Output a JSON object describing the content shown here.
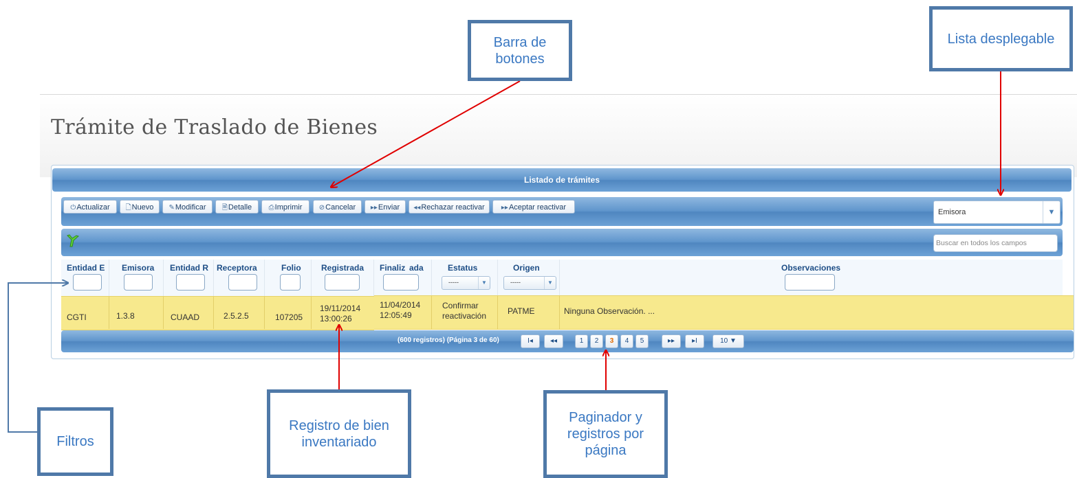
{
  "page": {
    "title": "Trámite de Traslado de Bienes"
  },
  "panel": {
    "title": "Listado de trámites"
  },
  "toolbar": {
    "buttons": [
      {
        "icon": "⏻",
        "label": "Actualizar"
      },
      {
        "icon": "🗋",
        "label": "Nuevo"
      },
      {
        "icon": "✎",
        "label": "Modificar"
      },
      {
        "icon": "🗎",
        "label": "Detalle"
      },
      {
        "icon": "⎙",
        "label": "Imprimir"
      },
      {
        "icon": "⊘",
        "label": "Cancelar"
      },
      {
        "icon": "▸▸",
        "label": "Enviar"
      },
      {
        "icon": "◂◂",
        "label": "Rechazar reactivar"
      },
      {
        "icon": "▸▸",
        "label": "Aceptar reactivar"
      }
    ],
    "dropdown_value": "Emisora",
    "search_placeholder": "Buscar en todos los campos"
  },
  "table": {
    "columns": [
      "Entidad E",
      "Emisora",
      "Entidad R",
      "Receptora",
      "Folio",
      "Registrada",
      "Finaliz",
      "ada",
      "Estatus",
      "Origen",
      "Observaciones"
    ],
    "filter_select_value": "-----",
    "row": {
      "entidad_e": "CGTI",
      "emisora": "1.3.8",
      "entidad_r": "CUAAD",
      "receptora": "2.5.2.5",
      "folio": "107205",
      "registrada_date": "19/11/2014",
      "registrada_time": "13:00:26",
      "finalizada_date": "11/04/2014",
      "finalizada_time": "12:05:49",
      "estatus_1": "Confirmar",
      "estatus_2": "reactivación",
      "origen": "PATME",
      "observaciones": "Ninguna Observación. ..."
    }
  },
  "pager": {
    "info": "(600 registros) (Página 3 de 60)",
    "first": "I◂",
    "prev": "◂◂",
    "pages": [
      "1",
      "2",
      "3",
      "4",
      "5"
    ],
    "current_page": "3",
    "next": "▸▸",
    "last": "▸I",
    "per_page": "10 ▼"
  },
  "annotations": {
    "barra": "Barra de botones",
    "lista": "Lista desplegable",
    "filtros": "Filtros",
    "registro": "Registro de bien inventariado",
    "paginador": "Paginador y registros por página"
  },
  "colors": {
    "bar_blue": "#5f95cc",
    "row_yellow": "#f7e98d",
    "arrow_red": "#e00000",
    "callout_border": "#4f79a8",
    "callout_text": "#3a78c2"
  }
}
